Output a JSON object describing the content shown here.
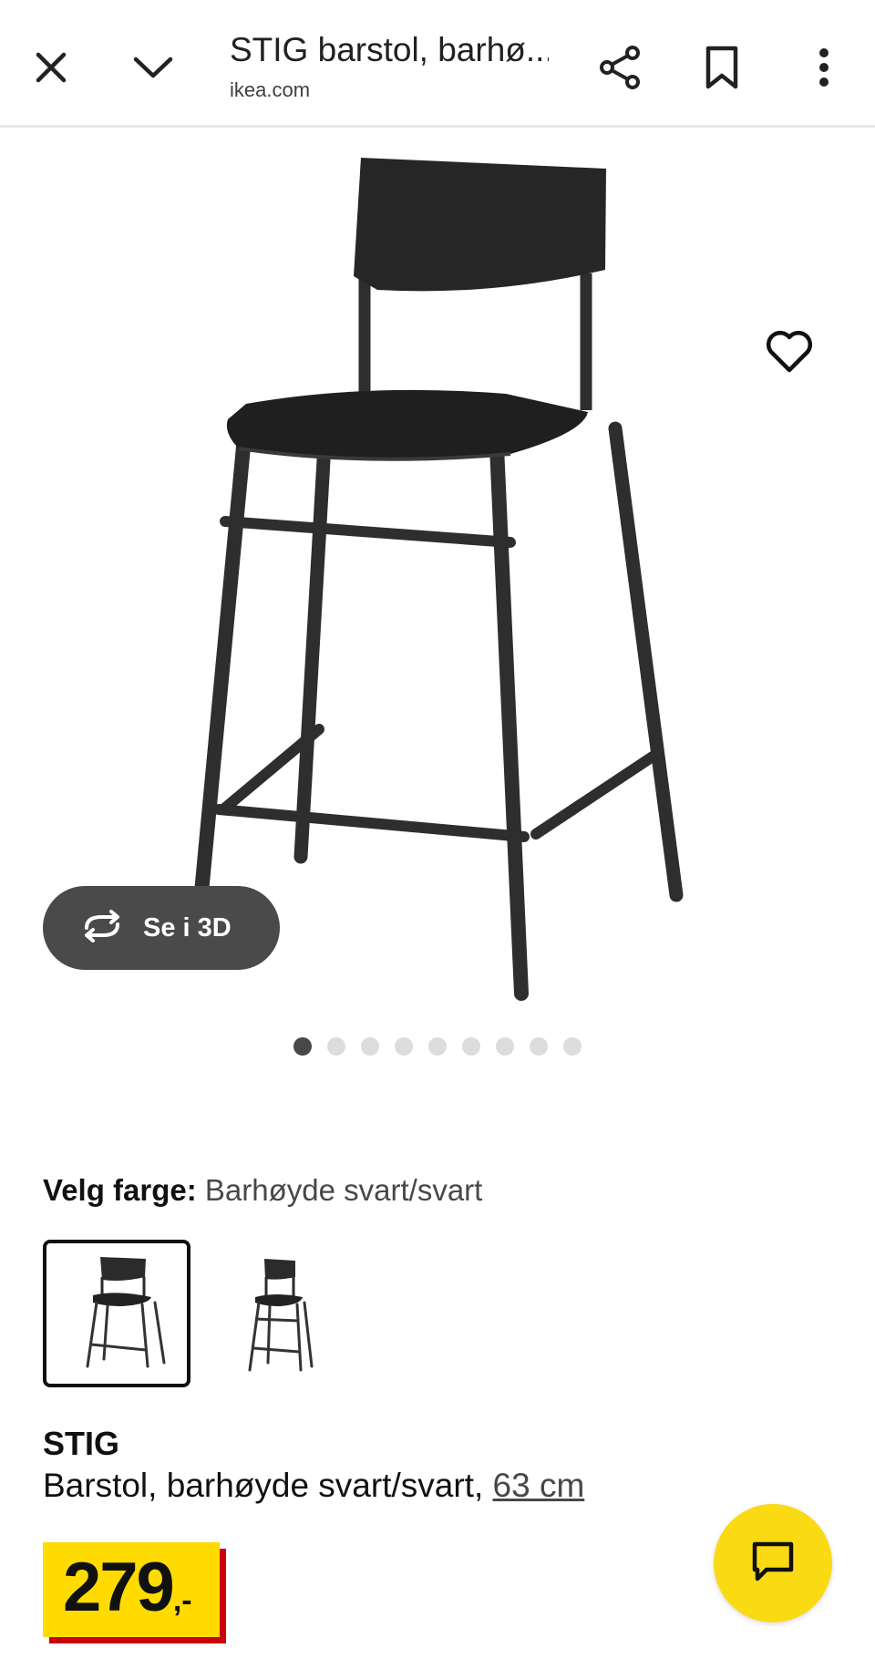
{
  "browser": {
    "title": "STIG barstol, barhø...",
    "domain": "ikea.com",
    "icons": [
      "close-icon",
      "chevron-down-icon",
      "share-icon",
      "bookmark-icon",
      "more-vert-icon"
    ]
  },
  "gallery": {
    "view_3d_label": "Se i 3D",
    "image_count": 9,
    "active_index": 0
  },
  "color_picker": {
    "label": "Velg farge:",
    "selected_value": "Barhøyde svart/svart",
    "options_count": 2
  },
  "product": {
    "name": "STIG",
    "description": "Barstol, barhøyde svart/svart,",
    "size_link": "63 cm",
    "price": "279",
    "price_suffix": ",-"
  },
  "colors": {
    "price_bg": "#ffdb00",
    "price_shadow": "#cc0008",
    "chat_bg": "#fada12",
    "chair": "#2b2b2b"
  }
}
